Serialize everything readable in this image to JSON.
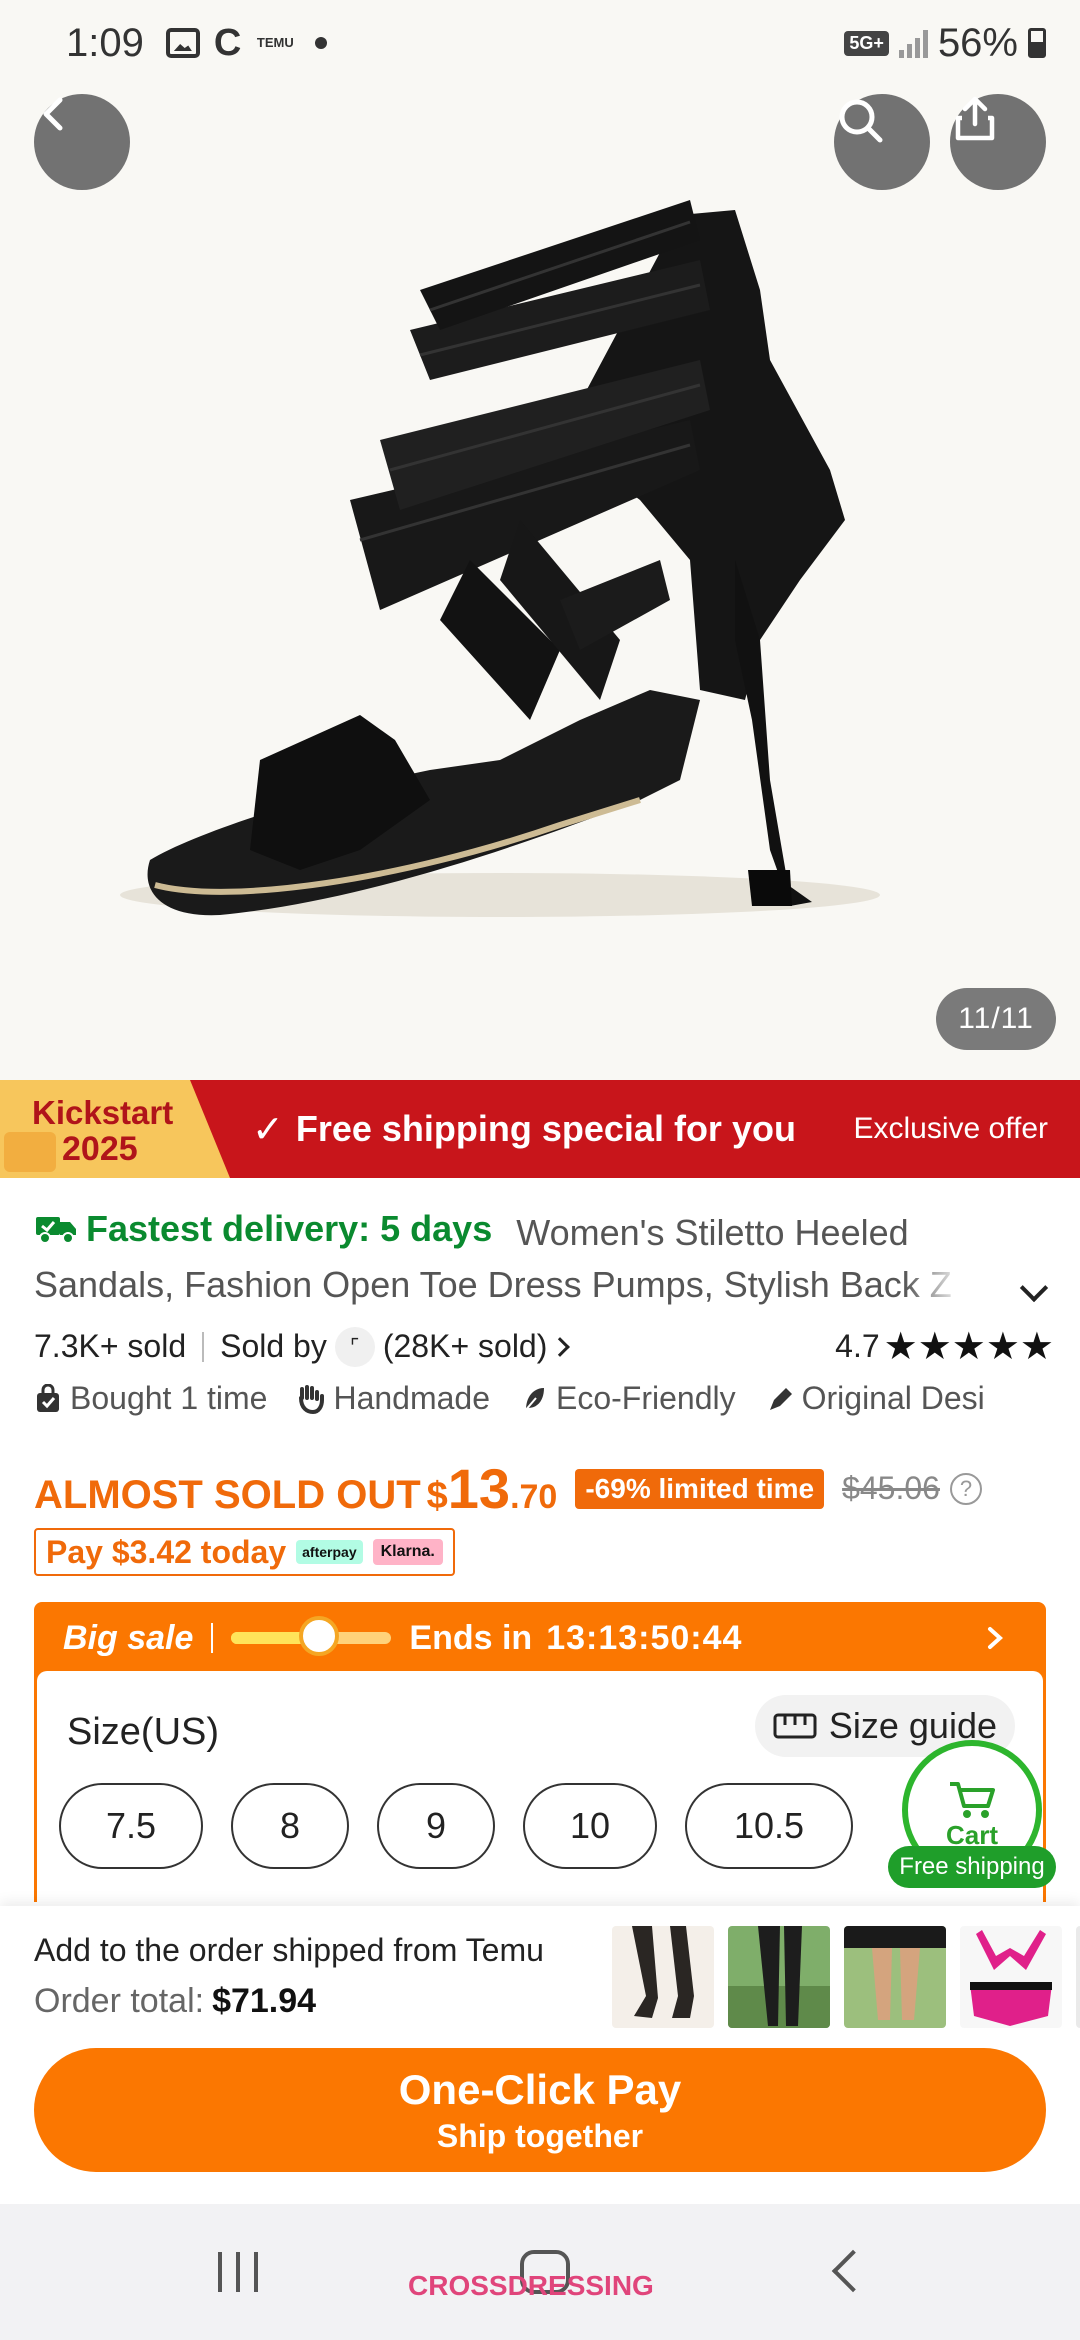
{
  "status_bar": {
    "time": "1:09",
    "temu_icon_text": "TEMU",
    "network": "5G+",
    "battery": "56%"
  },
  "gallery": {
    "counter": "11/11",
    "icons": [
      "back-icon",
      "search-icon",
      "share-icon"
    ]
  },
  "promo": {
    "kickstart_line1": "Kickstart",
    "kickstart_line2": "2025",
    "main": "Free shipping special for you",
    "right": "Exclusive offer",
    "check_icon": "✓"
  },
  "product": {
    "fastest": "Fastest delivery: 5 days",
    "title_line1": "Women's Stiletto Heeled",
    "title_line2": "Sandals, Fashion Open Toe Dress Pumps, Stylish Back Z",
    "sold": "7.3K+ sold",
    "sold_by_label": "Sold by",
    "seller_sold": "(28K+ sold)",
    "rating": "4.7",
    "stars": "★★★★★",
    "badges": [
      {
        "label": "Bought 1 time",
        "icon": "bag-check-icon"
      },
      {
        "label": "Handmade",
        "icon": "hand-icon"
      },
      {
        "label": "Eco-Friendly",
        "icon": "leaf-icon"
      },
      {
        "label": "Original Desi",
        "icon": "pen-icon"
      }
    ],
    "almost_sold_out": "ALMOST SOLD OUT",
    "price_symbol": "$",
    "price_int": "13",
    "price_dec": ".70",
    "discount": "-69% limited time",
    "original_price": "$45.06",
    "pay_today": "Pay $3.42 today",
    "afterpay": "afterpay",
    "klarna": "Klarna."
  },
  "sale": {
    "title": "Big sale",
    "ends_label": "Ends in",
    "ends_time": "13:13:50:44",
    "progress": 0.55,
    "size_label": "Size(US)",
    "size_guide": "Size guide",
    "sizes": [
      "7.5",
      "8",
      "9",
      "10",
      "10.5"
    ]
  },
  "cart": {
    "label": "Cart",
    "free_shipping": "Free shipping"
  },
  "order": {
    "line1": "Add to the order shipped from Temu",
    "total_label": "Order total:",
    "total_value": "$71.94",
    "cta_main": "One-Click Pay",
    "cta_sub": "Ship together"
  },
  "navbar": {
    "watermark": "CROSSDRESSING"
  },
  "colors": {
    "accent": "#fb7701",
    "promo_red": "#c8151b",
    "delivery_green": "#0a8a2f"
  }
}
